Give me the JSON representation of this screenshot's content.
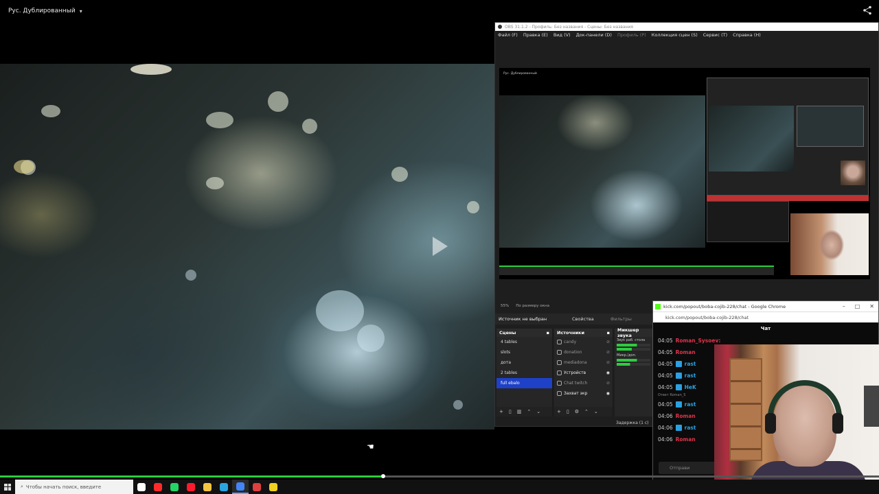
{
  "player": {
    "audio_track": "Рус. Дублированный",
    "progress_fraction": 0.436
  },
  "obs": {
    "window_title": "OBS 31.1.2 - Профиль: Без названия - Сцены: Без названия",
    "menu": [
      "Файл (F)",
      "Правка (E)",
      "Вид (V)",
      "Док-панели (D)",
      "Профиль (P)",
      "Коллекция сцен (S)",
      "Сервис (T)",
      "Справка (H)"
    ],
    "preview_label": "Рус. Дублированный",
    "zoom": "55%",
    "fit_label": "По размеру окна",
    "no_source": "Источник не выбран",
    "properties": "Свойства",
    "filters": "Фильтры",
    "scenes_title": "Сцены",
    "scenes": [
      "4 tables",
      "slots",
      "дота",
      "2 tables",
      "full ebalo"
    ],
    "selected_scene": "full ebalo",
    "sources_title": "Источники",
    "sources": [
      {
        "label": "candy",
        "on": false
      },
      {
        "label": "donation",
        "on": false
      },
      {
        "label": "mediadona",
        "on": false
      },
      {
        "label": "Устройств",
        "on": true
      },
      {
        "label": "Chat twitch",
        "on": false
      },
      {
        "label": "Захват экр",
        "on": true
      }
    ],
    "mixer_title": "Микшер звука",
    "mixer_channels": [
      "Звук раб. стола",
      "Микр./доп."
    ],
    "delay": "Задержка (1 с)"
  },
  "chat": {
    "window_title": "kick.com/popout/boba-cojib-228/chat - Google Chrome",
    "url": "kick.com/popout/boba-cojib-228/chat",
    "header": "Чат",
    "messages": [
      {
        "time": "04:05",
        "user": "Roman_Sysoev:",
        "color": "#e0344a",
        "badge": false
      },
      {
        "time": "04:05",
        "user": "Roman",
        "color": "#e0344a",
        "badge": false
      },
      {
        "time": "04:05",
        "user": "rast",
        "color": "#2aa0e0",
        "badge": true
      },
      {
        "time": "04:05",
        "user": "rast",
        "color": "#2aa0e0",
        "badge": true
      },
      {
        "time": "04:05",
        "user": "HeK",
        "color": "#2aa0e0",
        "badge": true
      },
      {
        "time": "04:05",
        "user": "rast",
        "color": "#2aa0e0",
        "badge": true
      },
      {
        "time": "04:06",
        "user": "Roman",
        "color": "#e0344a",
        "badge": false
      },
      {
        "time": "04:06",
        "user": "rast",
        "color": "#2aa0e0",
        "badge": true
      },
      {
        "time": "04:06",
        "user": "Roman",
        "color": "#e0344a",
        "badge": false
      }
    ],
    "reply_label": "Ответ Roman_S",
    "input_placeholder": "Отправи"
  },
  "taskbar": {
    "search_placeholder": "Чтобы начать поиск, введите",
    "apps": [
      {
        "name": "tiktok-icon",
        "color": "#ffffff"
      },
      {
        "name": "youtube-icon",
        "color": "#ff2b2b"
      },
      {
        "name": "whatsapp-icon",
        "color": "#25d366"
      },
      {
        "name": "opera-icon",
        "color": "#ff1b2d"
      },
      {
        "name": "folder-icon",
        "color": "#f4c542"
      },
      {
        "name": "telegram-icon",
        "color": "#2aa3e0"
      },
      {
        "name": "chrome-icon",
        "color": "#4285f4"
      },
      {
        "name": "obs-icon",
        "color": "#e04040"
      },
      {
        "name": "app-icon",
        "color": "#f0d020"
      }
    ]
  }
}
